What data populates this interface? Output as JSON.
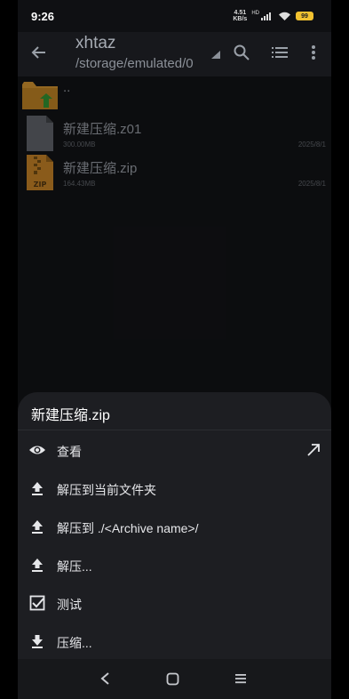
{
  "status_bar": {
    "time": "9:26",
    "net_speed_value": "4.51",
    "net_speed_unit": "KB/s",
    "network_type": "HD",
    "battery_level": "99"
  },
  "toolbar": {
    "title": "xhtaz",
    "path": "/storage/emulated/0",
    "icons": [
      "back-arrow-icon",
      "search-icon",
      "list-view-icon",
      "more-vert-icon"
    ]
  },
  "files": [
    {
      "name": "..",
      "icon": "folder-up-icon"
    },
    {
      "name": "新建压缩.z01",
      "size": "300.00MB",
      "date": "2025/8/1",
      "icon": "file-icon"
    },
    {
      "name": "新建压缩.zip",
      "size": "164.43MB",
      "date": "2025/8/1",
      "icon": "zip-file-icon",
      "icon_label": "ZIP"
    }
  ],
  "sheet": {
    "title": "新建压缩.zip",
    "items": [
      {
        "label": "查看",
        "icon": "eye-icon",
        "trailing_icon": "open-external-icon"
      },
      {
        "label": "解压到当前文件夹",
        "icon": "upload-icon"
      },
      {
        "label": "解压到 ./<Archive name>/",
        "icon": "upload-icon"
      },
      {
        "label": "解压...",
        "icon": "upload-icon"
      },
      {
        "label": "测试",
        "icon": "checkbox-icon"
      },
      {
        "label": "压缩...",
        "icon": "download-icon"
      }
    ]
  },
  "colors": {
    "background": "#111215",
    "sheet": "#1d1e22",
    "folder": "#c48a2c",
    "arrow_green": "#2f8a2f",
    "zip_orange": "#b87a25"
  }
}
